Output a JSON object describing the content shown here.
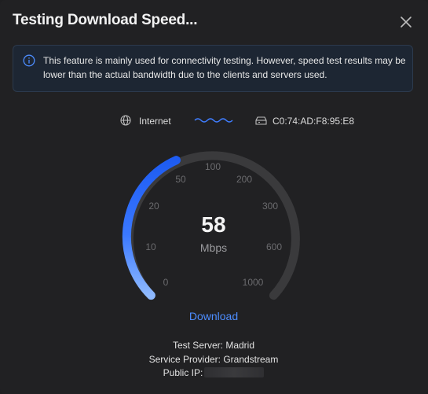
{
  "dialog": {
    "title": "Testing Download Speed..."
  },
  "notice": {
    "text": "This feature is mainly used for connectivity testing. However, speed test results may be lower than the actual bandwidth due to the clients and servers used."
  },
  "connection": {
    "internet_label": "Internet",
    "device_mac": "C0:74:AD:F8:95:E8",
    "icons": [
      "globe-icon",
      "signal-wave-icon",
      "router-icon"
    ]
  },
  "gauge": {
    "value": "58",
    "unit": "Mbps",
    "scale_labels": [
      "0",
      "10",
      "20",
      "50",
      "100",
      "200",
      "300",
      "600",
      "1000"
    ],
    "colors": {
      "track": "#3a3a3c",
      "fill_start": "#7fb1ff",
      "fill_end": "#1f5cf0"
    }
  },
  "test": {
    "mode_label": "Download",
    "server_line": "Test Server: Madrid",
    "provider_line": "Service Provider: Grandstream",
    "public_ip_label": "Public IP:"
  },
  "colors": {
    "background": "#212123",
    "accent": "#4d8dff",
    "notice_bg": "#1d2633"
  }
}
